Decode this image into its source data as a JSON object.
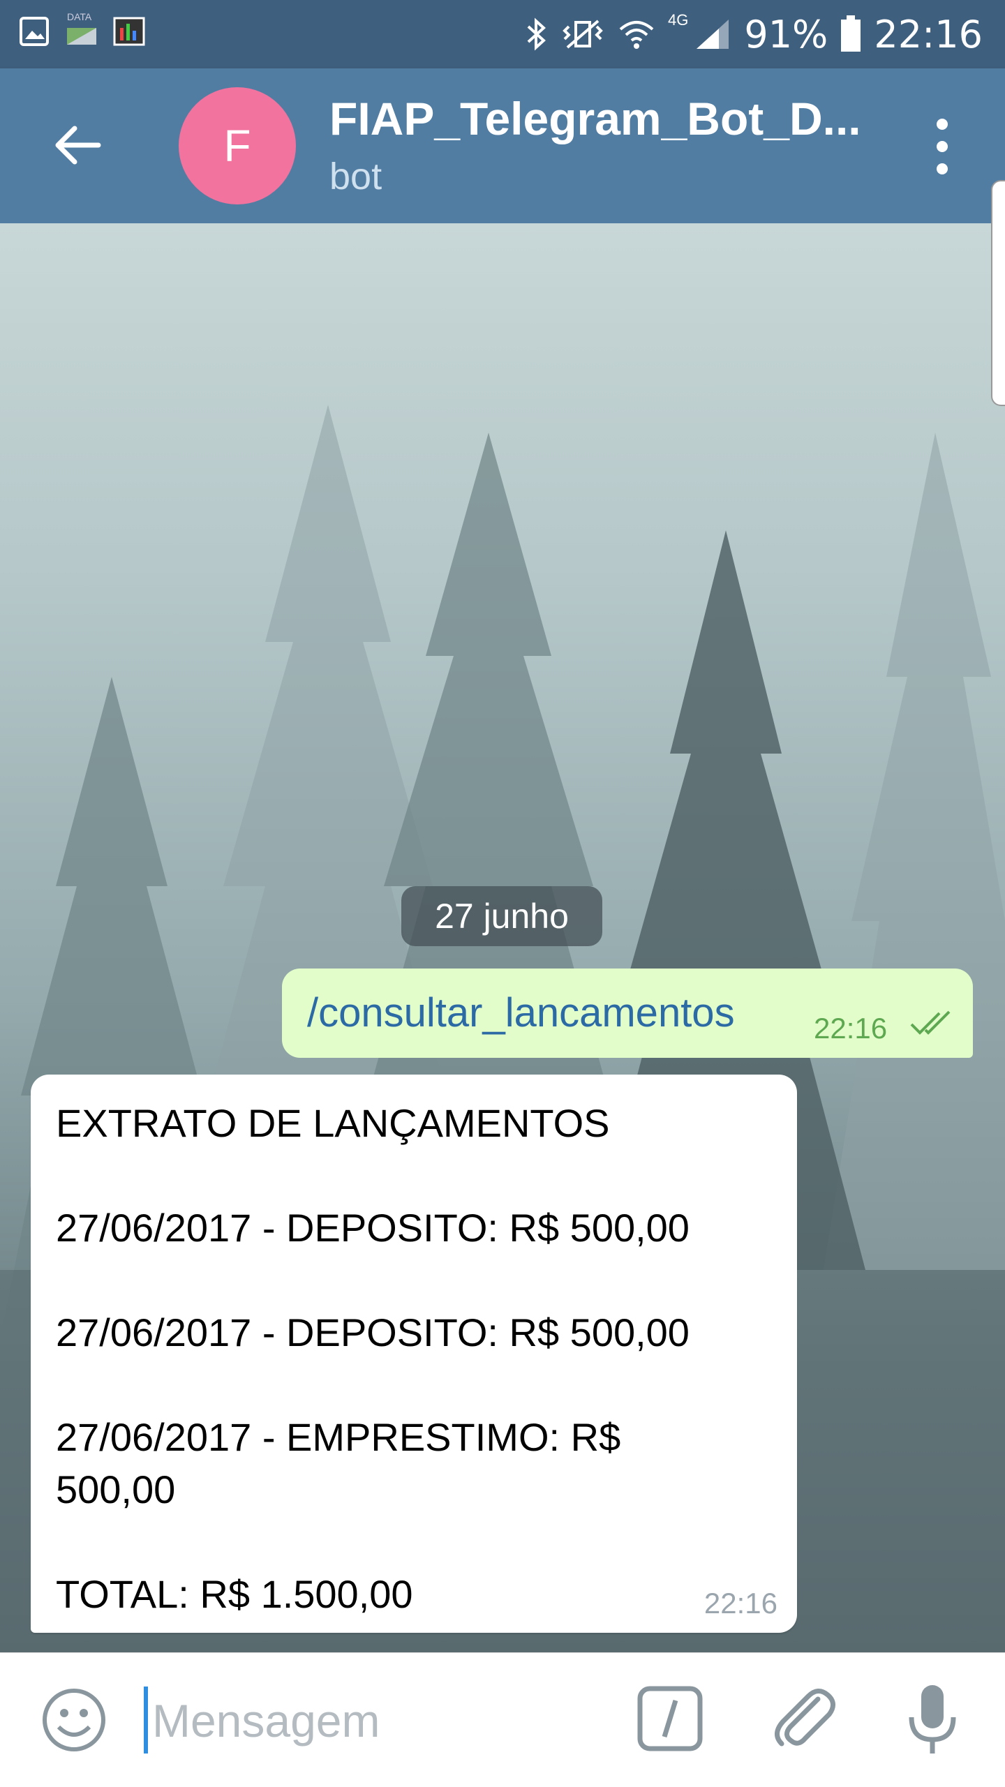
{
  "status_bar": {
    "left_icons": [
      "gallery-icon",
      "data-saver-icon",
      "taskbar-icon"
    ],
    "data_label": "DATA",
    "network_label": "4G",
    "battery": "91%",
    "time": "22:16"
  },
  "header": {
    "avatar_letter": "F",
    "title": "FIAP_Telegram_Bot_D...",
    "subtitle": "bot"
  },
  "chat": {
    "date_chip": "27 junho",
    "outgoing": {
      "text": "/consultar_lancamentos",
      "time": "22:16",
      "status": "read"
    },
    "incoming": {
      "lines": [
        "EXTRATO DE LANÇAMENTOS",
        "27/06/2017 - DEPOSITO: R$ 500,00",
        "27/06/2017 - DEPOSITO: R$ 500,00",
        "27/06/2017 - EMPRESTIMO: R$ 500,00",
        "TOTAL: R$ 1.500,00"
      ],
      "time": "22:16"
    }
  },
  "input_bar": {
    "placeholder": "Mensagem"
  },
  "colors": {
    "header": "#527da3",
    "status_bar": "#3f5f7f",
    "outgoing_bubble": "#e2fdc9",
    "avatar": "#f2739e",
    "link_text": "#2b6aa5"
  }
}
